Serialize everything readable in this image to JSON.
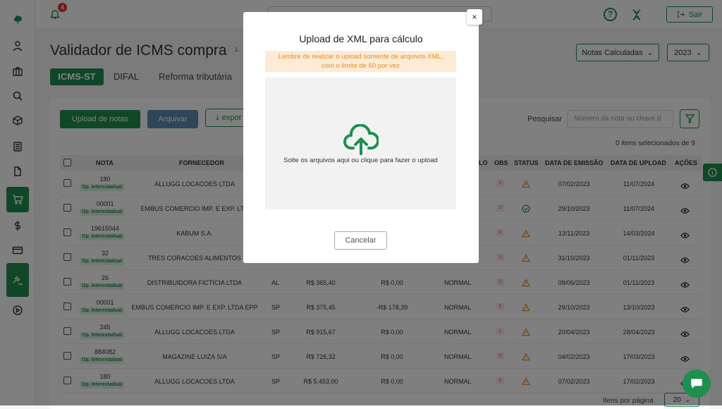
{
  "header": {
    "notification_count": "4",
    "logout_label": "Sair"
  },
  "page": {
    "title": "Validador de ICMS compra",
    "title_sup": "1.",
    "status_filter": "Notas Calculadas",
    "year": "2023"
  },
  "tabs": [
    "ICMS-ST",
    "DIFAL",
    "Reforma tributária"
  ],
  "toolbar": {
    "upload_label": "Upload de notas",
    "archive_label": "Arquivar",
    "export_label": "expor",
    "search_label": "Pesquisar",
    "search_placeholder": "Número da nota ou chave d",
    "selected_count": "0 itens selecionados de 9"
  },
  "table": {
    "columns": {
      "nota": "NOTA",
      "fornecedor": "FORNECEDOR",
      "calculo": "LO",
      "obs": "OBS",
      "status": "STATUS",
      "data_emissao": "DATA DE EMISSÃO",
      "data_upload": "DATA DE UPLOAD",
      "acoes": "AÇÕES"
    },
    "badge_label": "Op. Interestadual",
    "rows": [
      {
        "nota": "180",
        "fornecedor": "ALLUGG LOCACOES LTDA",
        "uf": "",
        "valor": "",
        "difal": "",
        "calc": "",
        "obs": "0",
        "status": "warning",
        "emissao": "07/02/2023",
        "upload": "11/07/2024"
      },
      {
        "nota": "00001",
        "fornecedor": "EMBUS COMERCIO IMP. E EXP. LTD",
        "uf": "",
        "valor": "",
        "difal": "",
        "calc": "",
        "obs": "2",
        "status": "ok",
        "emissao": "29/10/2023",
        "upload": "11/07/2024"
      },
      {
        "nota": "19615044",
        "fornecedor": "KABUM S.A.",
        "uf": "",
        "valor": "",
        "difal": "",
        "calc": "",
        "obs": "0",
        "status": "warning",
        "emissao": "13/11/2023",
        "upload": "14/03/2024"
      },
      {
        "nota": "32",
        "fornecedor": "TRES CORACOES ALIMENTOS",
        "uf": "",
        "valor": "",
        "difal": "",
        "calc": "",
        "obs": "3",
        "status": "warning",
        "emissao": "31/10/2023",
        "upload": "01/11/2023"
      },
      {
        "nota": "26",
        "fornecedor": "DISTRIBUIDORA FICTÍCIA LTDA",
        "uf": "AL",
        "valor": "R$ 365,40",
        "difal": "R$ 0,00",
        "calc": "NORMAL",
        "obs": "2",
        "status": "warning",
        "emissao": "09/06/2023",
        "upload": "01/11/2023"
      },
      {
        "nota": "00001",
        "fornecedor": "EMBUS COMERCIO IMP. E EXP. LTDA EPP",
        "uf": "SP",
        "valor": "R$ 375,45",
        "difal": "-R$ 178,39",
        "calc": "NORMAL",
        "obs": "5",
        "status": "warning",
        "emissao": "29/10/2023",
        "upload": "13/10/2023"
      },
      {
        "nota": "245",
        "fornecedor": "ALLUGG LOCACOES LTDA",
        "uf": "SP",
        "valor": "R$ 915,67",
        "difal": "R$ 0,00",
        "calc": "NORMAL",
        "obs": "1",
        "status": "warning",
        "emissao": "20/04/2023",
        "upload": "28/04/2023"
      },
      {
        "nota": "884082",
        "fornecedor": "MAGAZINE LUIZA S/A",
        "uf": "SP",
        "valor": "R$ 726,32",
        "difal": "R$ 0,00",
        "calc": "NORMAL",
        "obs": "0",
        "status": "warning",
        "emissao": "04/02/2023",
        "upload": "17/03/2023"
      },
      {
        "nota": "180",
        "fornecedor": "ALLUGG LOCACOES LTDA",
        "uf": "SP",
        "valor": "R$ 5.453,00",
        "difal": "R$ 0,00",
        "calc": "NORMAL",
        "obs": "0",
        "status": "warning",
        "emissao": "07/02/2023",
        "upload": "17/02/2023"
      }
    ]
  },
  "pagination": {
    "label": "Itens por página",
    "value": "20"
  },
  "modal": {
    "title": "Upload de XML para cálculo",
    "warning_line1": "Lembre de realizar o upload somente de arquivos XML,",
    "warning_line2": "com o limite de 60 por vez",
    "drop_text": "Solte os arquivos aqui ou clique para fazer o upload",
    "cancel_label": "Cancelar",
    "close_label": "×"
  },
  "colors": {
    "accent": "#1e8f4e",
    "warning": "#f08c1e",
    "danger": "#e53935"
  }
}
